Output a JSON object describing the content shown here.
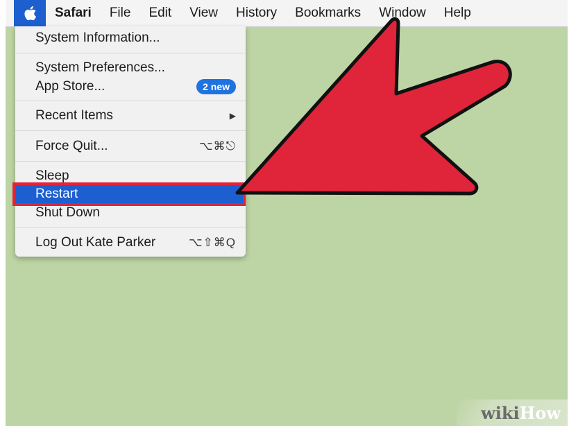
{
  "menubar": {
    "apple_icon": "apple-icon",
    "items": [
      {
        "label": "Safari"
      },
      {
        "label": "File"
      },
      {
        "label": "Edit"
      },
      {
        "label": "View"
      },
      {
        "label": "History"
      },
      {
        "label": "Bookmarks"
      },
      {
        "label": "Window"
      },
      {
        "label": "Help"
      }
    ]
  },
  "apple_menu": {
    "system_information": "System Information...",
    "system_preferences": "System Preferences...",
    "app_store": "App Store...",
    "app_store_badge": "2 new",
    "recent_items": "Recent Items",
    "recent_items_submenu": "▶",
    "force_quit": "Force Quit...",
    "force_quit_shortcut": "⌥⌘⎋",
    "sleep": "Sleep",
    "restart": "Restart",
    "shut_down": "Shut Down",
    "log_out": "Log Out Kate Parker",
    "log_out_shortcut": "⌥⇧⌘Q"
  },
  "watermark": {
    "wiki": "wiki",
    "how": "How"
  },
  "colors": {
    "desktop": "#bdd4a4",
    "highlight": "#1d5fd0",
    "annotation_red": "#e0243a",
    "badge": "#1f73e0"
  }
}
